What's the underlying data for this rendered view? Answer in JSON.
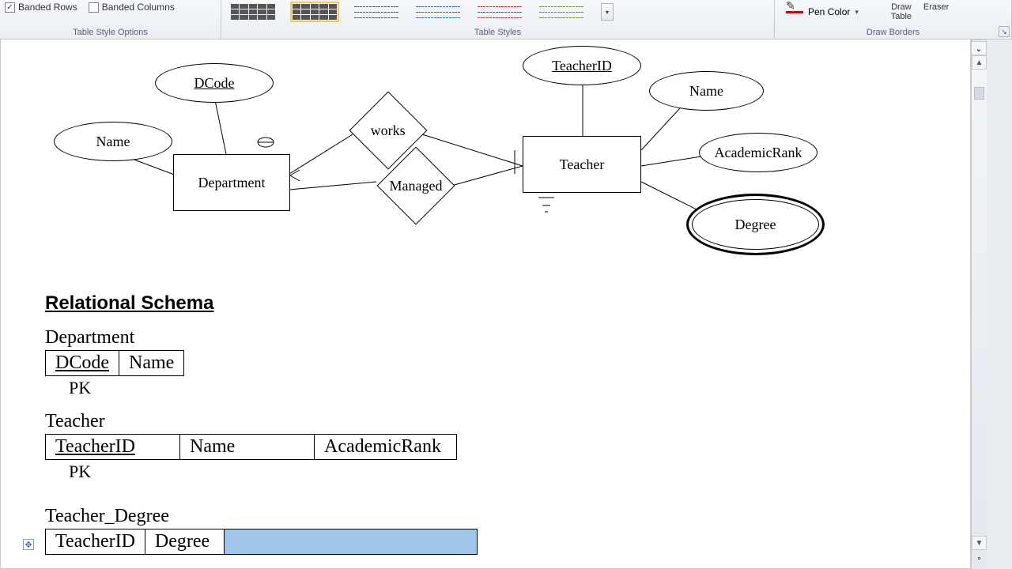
{
  "ribbon": {
    "tso_label": "Table Style Options",
    "banded_rows": "Banded Rows",
    "banded_cols": "Banded Columns",
    "styles_label": "Table Styles",
    "pen_color": "Pen Color",
    "draw_table": "Draw Table",
    "eraser": "Eraser",
    "borders_label": "Draw Borders"
  },
  "er": {
    "dcode": "DCode",
    "name_dept": "Name",
    "department": "Department",
    "works": "works",
    "managed": "Managed",
    "teacher": "Teacher",
    "teacherid": "TeacherID",
    "name_teacher": "Name",
    "academic_rank": "AcademicRank",
    "degree": "Degree"
  },
  "schema": {
    "heading": "Relational Schema",
    "dept": "Department",
    "dcode": "DCode",
    "name": "Name",
    "pk": "PK",
    "teacher": "Teacher",
    "teacherid": "TeacherID",
    "academic_rank": "AcademicRank",
    "teacher_degree": "Teacher_Degree",
    "degree": "Degree"
  },
  "chart_data": {
    "type": "table",
    "tables": [
      {
        "name": "Department",
        "columns": [
          "DCode",
          "Name"
        ],
        "primary_key": [
          "DCode"
        ]
      },
      {
        "name": "Teacher",
        "columns": [
          "TeacherID",
          "Name",
          "AcademicRank"
        ],
        "primary_key": [
          "TeacherID"
        ]
      },
      {
        "name": "Teacher_Degree",
        "columns": [
          "TeacherID",
          "Degree"
        ],
        "primary_key": []
      }
    ],
    "erd": {
      "entities": [
        "Department",
        "Teacher"
      ],
      "relationships": [
        {
          "name": "works",
          "between": [
            "Department",
            "Teacher"
          ]
        },
        {
          "name": "Managed",
          "between": [
            "Department",
            "Teacher"
          ]
        }
      ],
      "attributes": {
        "Department": [
          "DCode",
          "Name"
        ],
        "Teacher": [
          "TeacherID",
          "Name",
          "AcademicRank",
          "Degree"
        ]
      },
      "key_attributes": {
        "Department": "DCode",
        "Teacher": "TeacherID"
      },
      "multivalued_attributes": {
        "Teacher": [
          "Degree"
        ]
      }
    }
  }
}
